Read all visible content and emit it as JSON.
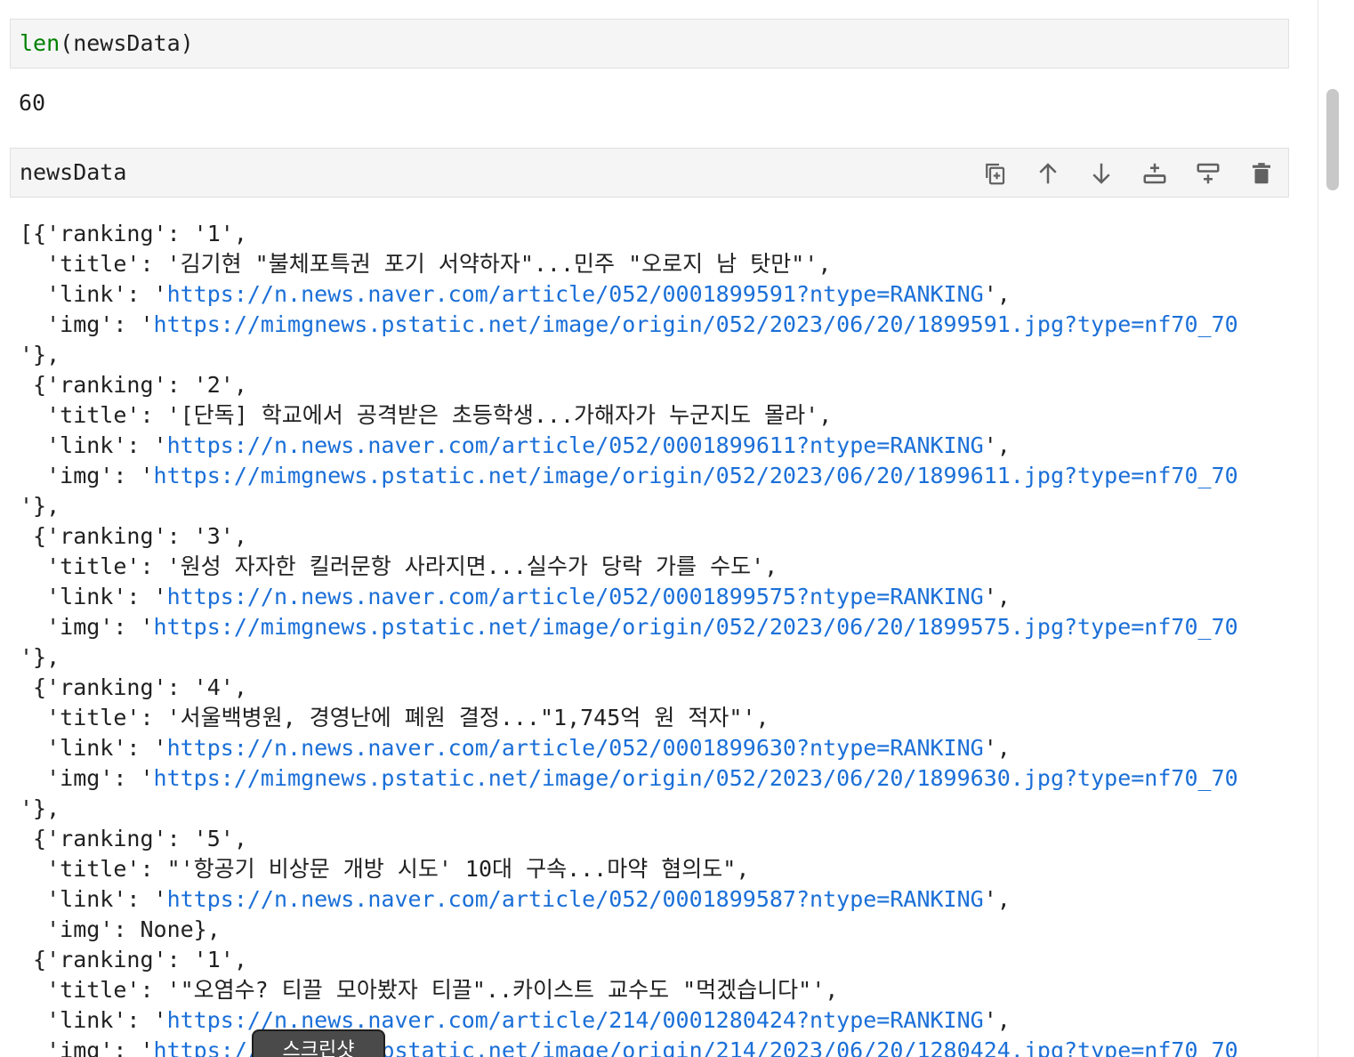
{
  "cells": [
    {
      "code_func": "len",
      "code_rest": "(newsData)",
      "result": "60"
    },
    {
      "code": "newsData",
      "toolbar": [
        {
          "name": "duplicate-cell",
          "icon": "copy-plus-icon"
        },
        {
          "name": "move-cell-up",
          "icon": "arrow-up-icon"
        },
        {
          "name": "move-cell-down",
          "icon": "arrow-down-icon"
        },
        {
          "name": "insert-cell-above",
          "icon": "insert-above-icon"
        },
        {
          "name": "insert-cell-below",
          "icon": "insert-below-icon"
        },
        {
          "name": "delete-cell",
          "icon": "trash-icon"
        }
      ]
    }
  ],
  "output_lines": [
    [
      {
        "t": "[{'ranking': '1',"
      }
    ],
    [
      {
        "t": "  'title': '김기현 \"불체포특권 포기 서약하자\"...민주 \"오로지 남 탓만\"',"
      }
    ],
    [
      {
        "t": "  'link': '"
      },
      {
        "t": "https://n.news.naver.com/article/052/0001899591?ntype=RANKING",
        "u": true
      },
      {
        "t": "',"
      }
    ],
    [
      {
        "t": "  'img': '"
      },
      {
        "t": "https://mimgnews.pstatic.net/image/origin/052/2023/06/20/1899591.jpg?type=nf70_70",
        "u": true
      }
    ],
    [
      {
        "t": "'},"
      }
    ],
    [
      {
        "t": " {'ranking': '2',"
      }
    ],
    [
      {
        "t": "  'title': '[단독] 학교에서 공격받은 초등학생...가해자가 누군지도 몰라',"
      }
    ],
    [
      {
        "t": "  'link': '"
      },
      {
        "t": "https://n.news.naver.com/article/052/0001899611?ntype=RANKING",
        "u": true
      },
      {
        "t": "',"
      }
    ],
    [
      {
        "t": "  'img': '"
      },
      {
        "t": "https://mimgnews.pstatic.net/image/origin/052/2023/06/20/1899611.jpg?type=nf70_70",
        "u": true
      }
    ],
    [
      {
        "t": "'},"
      }
    ],
    [
      {
        "t": " {'ranking': '3',"
      }
    ],
    [
      {
        "t": "  'title': '원성 자자한 킬러문항 사라지면...실수가 당락 가를 수도',"
      }
    ],
    [
      {
        "t": "  'link': '"
      },
      {
        "t": "https://n.news.naver.com/article/052/0001899575?ntype=RANKING",
        "u": true
      },
      {
        "t": "',"
      }
    ],
    [
      {
        "t": "  'img': '"
      },
      {
        "t": "https://mimgnews.pstatic.net/image/origin/052/2023/06/20/1899575.jpg?type=nf70_70",
        "u": true
      }
    ],
    [
      {
        "t": "'},"
      }
    ],
    [
      {
        "t": " {'ranking': '4',"
      }
    ],
    [
      {
        "t": "  'title': '서울백병원, 경영난에 폐원 결정...\"1,745억 원 적자\"',"
      }
    ],
    [
      {
        "t": "  'link': '"
      },
      {
        "t": "https://n.news.naver.com/article/052/0001899630?ntype=RANKING",
        "u": true
      },
      {
        "t": "',"
      }
    ],
    [
      {
        "t": "  'img': '"
      },
      {
        "t": "https://mimgnews.pstatic.net/image/origin/052/2023/06/20/1899630.jpg?type=nf70_70",
        "u": true
      }
    ],
    [
      {
        "t": "'},"
      }
    ],
    [
      {
        "t": " {'ranking': '5',"
      }
    ],
    [
      {
        "t": "  'title': \"'항공기 비상문 개방 시도' 10대 구속...마약 혐의도\","
      }
    ],
    [
      {
        "t": "  'link': '"
      },
      {
        "t": "https://n.news.naver.com/article/052/0001899587?ntype=RANKING",
        "u": true
      },
      {
        "t": "',"
      }
    ],
    [
      {
        "t": "  'img': None},"
      }
    ],
    [
      {
        "t": " {'ranking': '1',"
      }
    ],
    [
      {
        "t": "  'title': '\"오염수? 티끌 모아봤자 티끌\"..카이스트 교수도 \"먹겠습니다\"',"
      }
    ],
    [
      {
        "t": "  'link': '"
      },
      {
        "t": "https://n.news.naver.com/article/214/0001280424?ntype=RANKING",
        "u": true
      },
      {
        "t": "',"
      }
    ],
    [
      {
        "t": "  'img': '"
      },
      {
        "t": "https://mimgnews.pstatic.net/image/origin/214/2023/06/20/1280424.jpg?type=nf70_70",
        "u": true
      }
    ]
  ],
  "tooltip": "스크린샷",
  "colors": {
    "link": "#1a6fd8",
    "builtin": "#008000",
    "cell_bg": "#f5f5f5"
  }
}
